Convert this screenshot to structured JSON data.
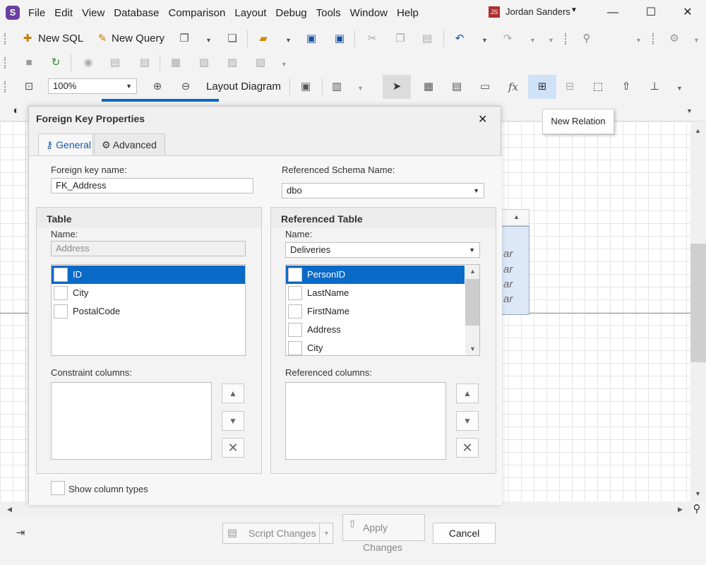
{
  "app": {
    "logo_letter": "S"
  },
  "menu": [
    "File",
    "Edit",
    "View",
    "Database",
    "Comparison",
    "Layout",
    "Debug",
    "Tools",
    "Window",
    "Help"
  ],
  "user": {
    "initials": "JS",
    "name": "Jordan Sanders"
  },
  "window_controls": {
    "minimize": "—",
    "maximize": "☐",
    "close": "✕"
  },
  "toolbar1": {
    "new_sql": "New SQL",
    "new_query": "New Query"
  },
  "toolbar3": {
    "zoom": "100%",
    "layout_diagram": "Layout Diagram"
  },
  "tooltip": {
    "text": "New Relation"
  },
  "canvas": {
    "entity_rows": [
      "ar",
      "ar",
      "ar",
      "ar"
    ]
  },
  "dialog": {
    "title": "Foreign Key Properties",
    "close": "✕",
    "tabs": [
      {
        "label": "General",
        "icon": "key-icon"
      },
      {
        "label": "Advanced",
        "icon": "gear-icon"
      }
    ],
    "fk_name_label": "Foreign key name:",
    "fk_name_value": "FK_Address",
    "ref_schema_label": "Referenced Schema Name:",
    "ref_schema_value": "dbo",
    "table": {
      "title": "Table",
      "name_label": "Name:",
      "name_value": "Address",
      "columns": [
        "ID",
        "City",
        "PostalCode"
      ],
      "selected": "ID",
      "constraint_label": "Constraint columns:"
    },
    "ref_table": {
      "title": "Referenced Table",
      "name_label": "Name:",
      "name_value": "Deliveries",
      "columns": [
        "PersonID",
        "LastName",
        "FirstName",
        "Address",
        "City"
      ],
      "selected": "PersonID",
      "ref_columns_label": "Referenced columns:"
    },
    "show_column_types": "Show column types"
  },
  "footer": {
    "script_changes": "Script Changes",
    "apply_changes": "Apply Changes",
    "cancel": "Cancel"
  }
}
